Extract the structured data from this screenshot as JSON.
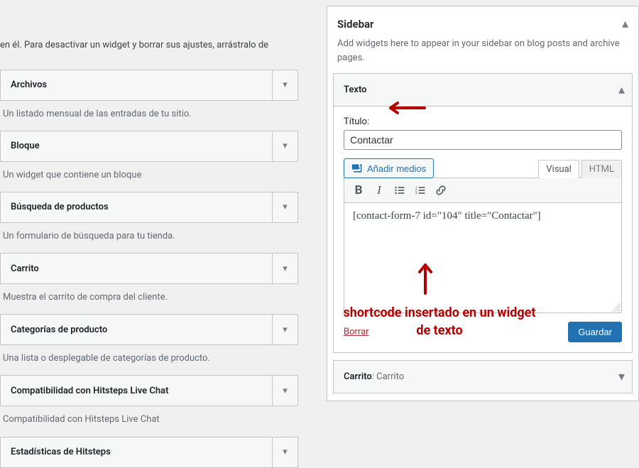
{
  "intro": "en él. Para desactivar un widget y borrar sus ajustes, arrástralo de",
  "widgets": [
    {
      "title": "Archivos",
      "desc": "Un listado mensual de las entradas de tu sitio."
    },
    {
      "title": "Bloque",
      "desc": "Un widget que contiene un bloque"
    },
    {
      "title": "Búsqueda de productos",
      "desc": "Un formulario de búsqueda para tu tienda."
    },
    {
      "title": "Carrito",
      "desc": "Muestra el carrito de compra del cliente."
    },
    {
      "title": "Categorías de producto",
      "desc": "Una lista o desplegable de categorías de producto."
    },
    {
      "title": "Compatibilidad con Hitsteps Live Chat",
      "desc": "Compatibilidad con Hitsteps Live Chat"
    },
    {
      "title": "Estadísticas de Hitsteps",
      "desc": ""
    }
  ],
  "sidebar": {
    "title": "Sidebar",
    "desc": "Add widgets here to appear in your sidebar on blog posts and archive pages."
  },
  "texto_widget": {
    "header": "Texto",
    "title_label": "Título:",
    "title_value": "Contactar",
    "add_media": "Añadir medios",
    "tab_visual": "Visual",
    "tab_html": "HTML",
    "editor_content": "[contact-form-7 id=\"104\" title=\"Contactar\"]",
    "delete": "Borrar",
    "save": "Guardar"
  },
  "collapsed_widget": {
    "name": "Carrito",
    "suffix": ": Carrito"
  },
  "annotation": "shortcode insertado en un widget de texto"
}
